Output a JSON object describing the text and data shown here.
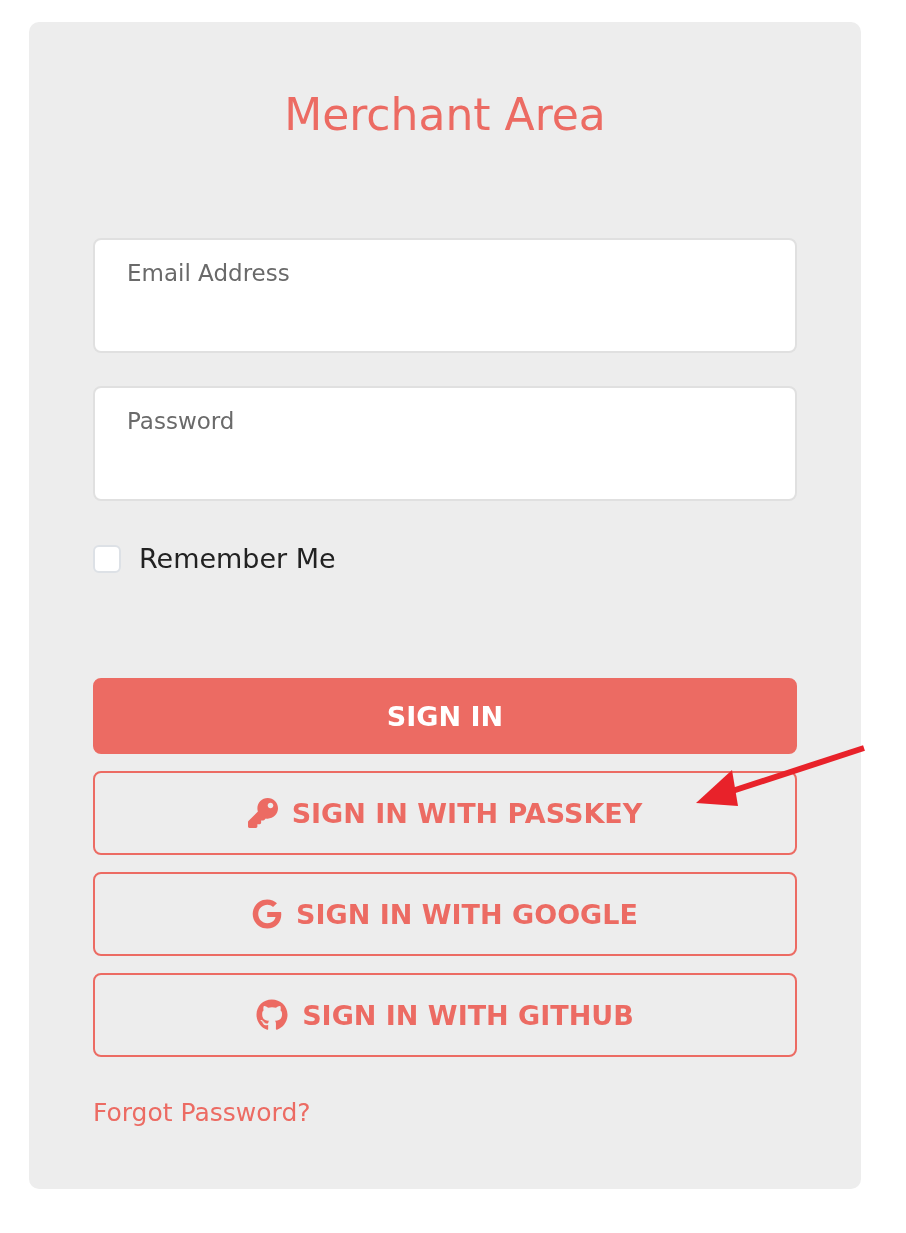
{
  "title": "Merchant Area",
  "fields": [
    {
      "placeholder": "Email Address"
    },
    {
      "placeholder": "Password"
    }
  ],
  "remember": {
    "label": "Remember Me",
    "checked": false
  },
  "buttons": [
    {
      "kind": "primary",
      "label": "SIGN IN"
    },
    {
      "kind": "passkey",
      "label": "SIGN IN WITH PASSKEY"
    },
    {
      "kind": "google",
      "label": "SIGN IN WITH GOOGLE"
    },
    {
      "kind": "github",
      "label": "SIGN IN WITH GITHUB"
    }
  ],
  "forgot_link": "Forgot Password?"
}
